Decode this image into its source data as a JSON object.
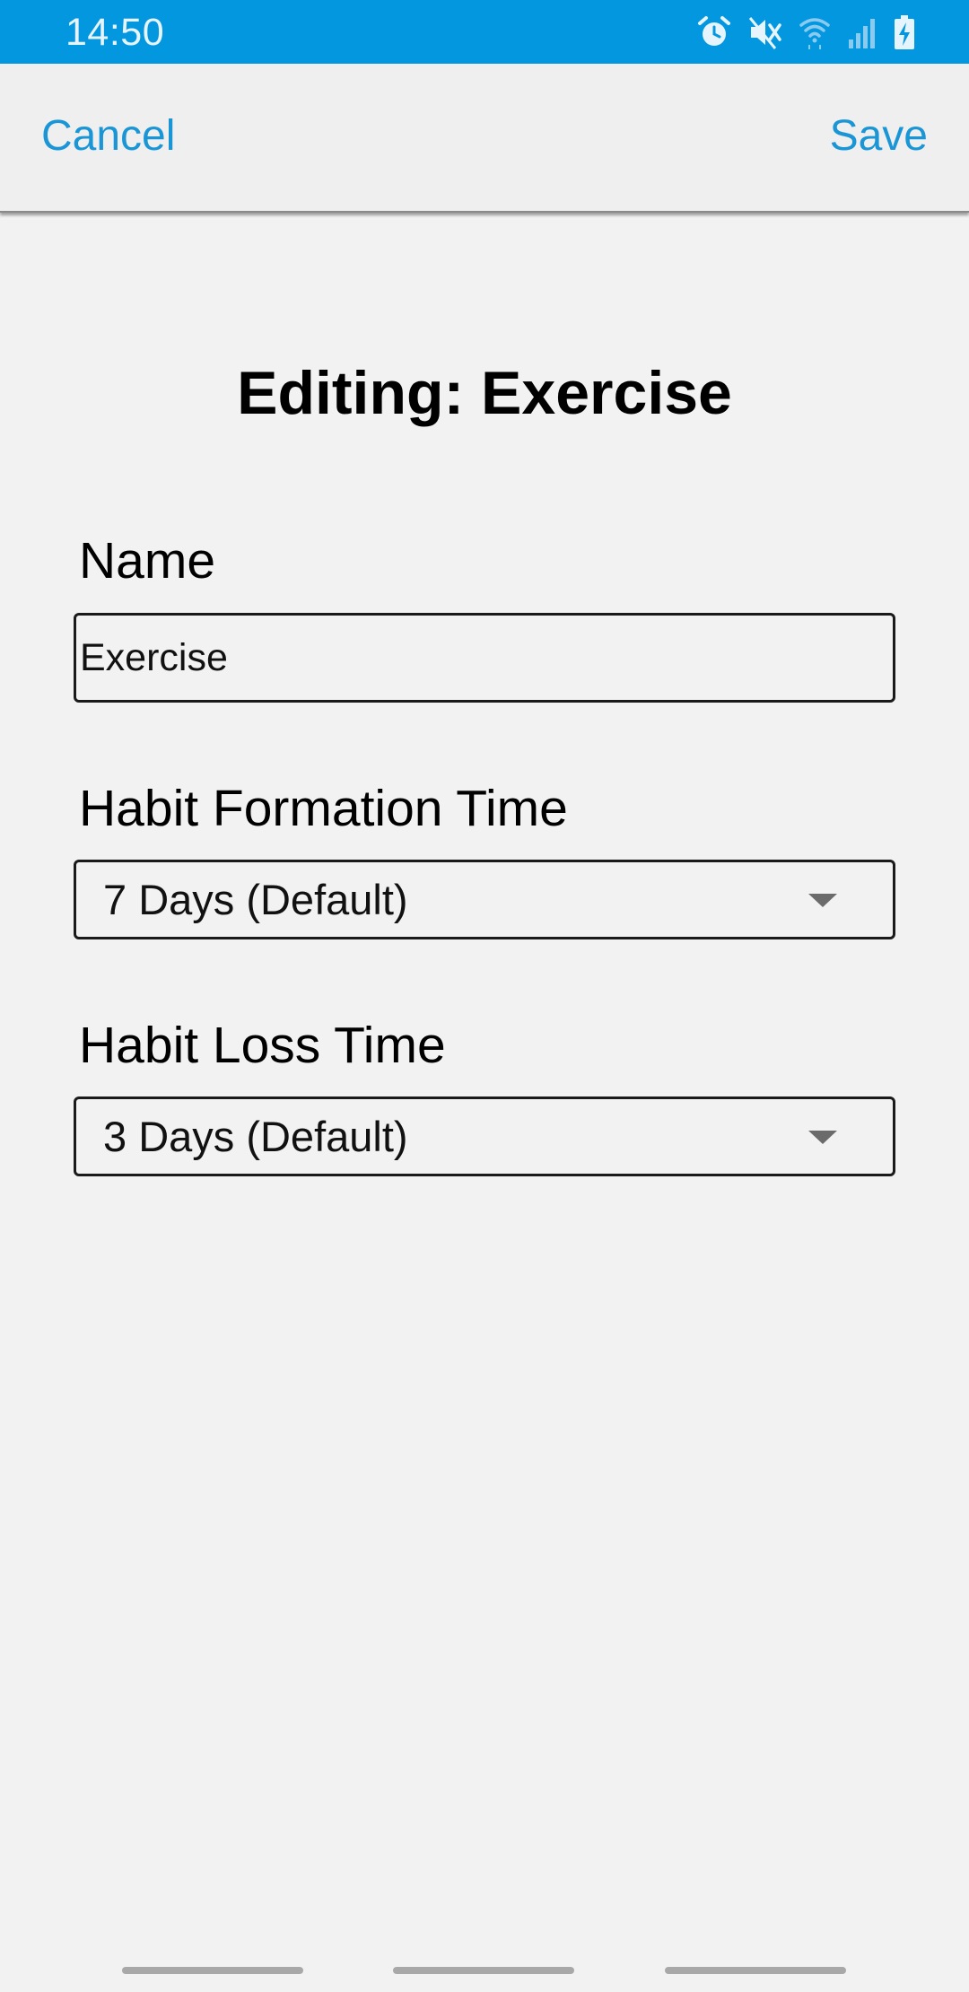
{
  "status_bar": {
    "time": "14:50",
    "icons": [
      "alarm-icon",
      "mute-icon",
      "wifi-icon",
      "signal-icon",
      "battery-charging-icon"
    ],
    "background_color": "#0397e0"
  },
  "app_bar": {
    "cancel_label": "Cancel",
    "save_label": "Save",
    "accent_color": "#1a96d6"
  },
  "main": {
    "title": "Editing: Exercise",
    "name": {
      "label": "Name",
      "value": "Exercise"
    },
    "habit_formation_time": {
      "label": "Habit Formation Time",
      "selected": "7 Days (Default)"
    },
    "habit_loss_time": {
      "label": "Habit Loss Time",
      "selected": "3 Days (Default)"
    }
  },
  "nav_bar": {
    "icons": [
      "recents-handle",
      "home-handle",
      "back-handle"
    ]
  }
}
